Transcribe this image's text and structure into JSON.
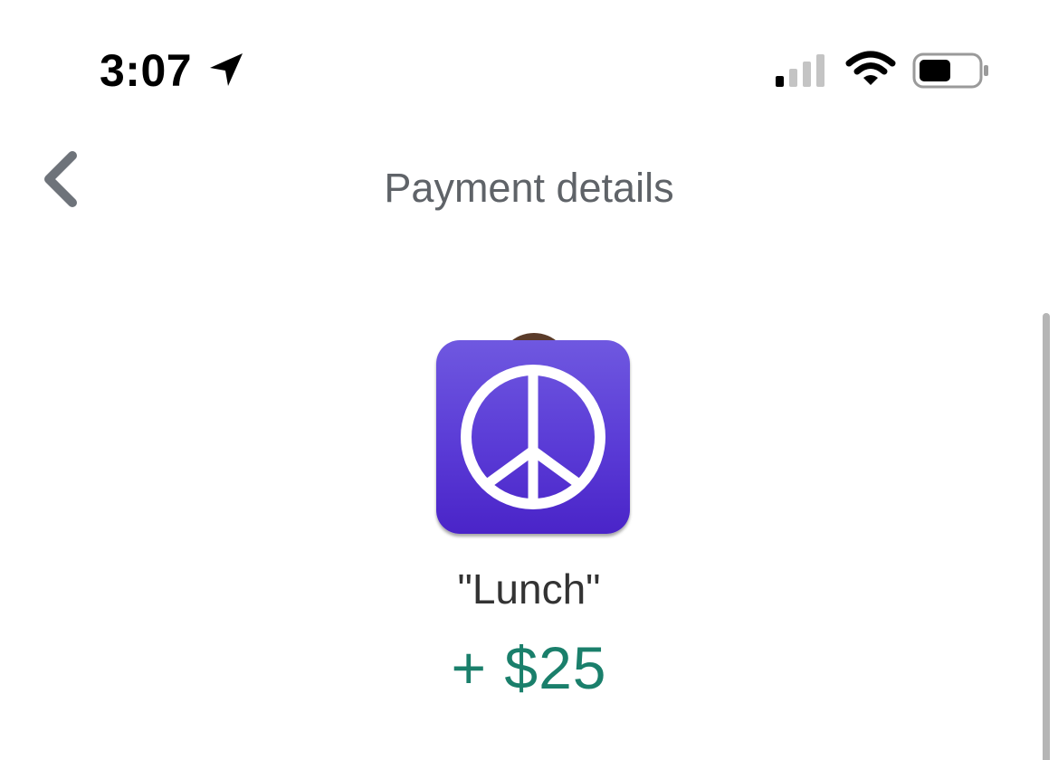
{
  "status_bar": {
    "time": "3:07",
    "icons": [
      "location-arrow-icon",
      "cellular-signal-icon",
      "wifi-icon",
      "battery-icon"
    ]
  },
  "nav": {
    "back_icon": "chevron-left-icon",
    "title": "Payment details"
  },
  "payment": {
    "avatar_icon": "peace-sign-icon",
    "memo": "\"Lunch\"",
    "amount": "+ $25"
  },
  "colors": {
    "amount": "#1a7f6b",
    "title": "#5f6368",
    "avatar_purple": "#5a3bd6"
  }
}
